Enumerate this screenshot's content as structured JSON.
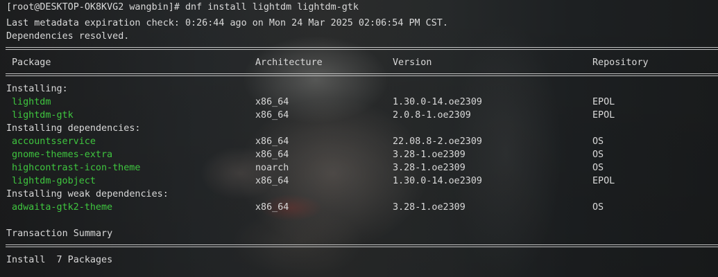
{
  "terminal": {
    "prompt": "[root@DESKTOP-OK8KVG2 wangbin]# ",
    "command": "dnf install lightdm lightdm-gtk",
    "metadata_line": "Last metadata expiration check: 0:26:44 ago on Mon 24 Mar 2025 02:06:54 PM CST.",
    "deps_resolved": "Dependencies resolved.",
    "headers": {
      "package": "Package",
      "architecture": "Architecture",
      "version": "Version",
      "repository": "Repository"
    },
    "groups": [
      {
        "title": "Installing:",
        "rows": [
          {
            "package": "lightdm",
            "arch": "x86_64",
            "version": "1.30.0-14.oe2309",
            "repo": "EPOL"
          },
          {
            "package": "lightdm-gtk",
            "arch": "x86_64",
            "version": "2.0.8-1.oe2309",
            "repo": "EPOL"
          }
        ]
      },
      {
        "title": "Installing dependencies:",
        "rows": [
          {
            "package": "accountsservice",
            "arch": "x86_64",
            "version": "22.08.8-2.oe2309",
            "repo": "OS"
          },
          {
            "package": "gnome-themes-extra",
            "arch": "x86_64",
            "version": "3.28-1.oe2309",
            "repo": "OS"
          },
          {
            "package": "highcontrast-icon-theme",
            "arch": "noarch",
            "version": "3.28-1.oe2309",
            "repo": "OS"
          },
          {
            "package": "lightdm-gobject",
            "arch": "x86_64",
            "version": "1.30.0-14.oe2309",
            "repo": "EPOL"
          }
        ]
      },
      {
        "title": "Installing weak dependencies:",
        "rows": [
          {
            "package": "adwaita-gtk2-theme",
            "arch": "x86_64",
            "version": "3.28-1.oe2309",
            "repo": "OS"
          }
        ]
      }
    ],
    "transaction_summary": "Transaction Summary",
    "install_summary": "Install  7 Packages"
  },
  "colors": {
    "package_name": "#3fc63f",
    "text": "#d9d9d9"
  }
}
